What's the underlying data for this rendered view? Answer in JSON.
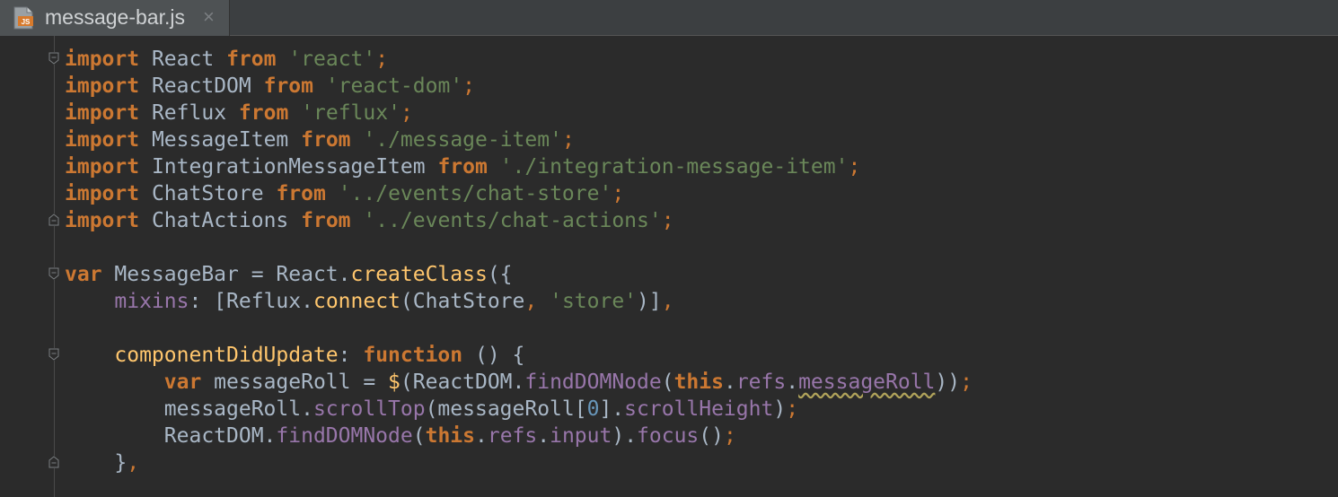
{
  "tab": {
    "filename": "message-bar.js",
    "close": "×",
    "icon_label": "JS"
  },
  "code": {
    "l1": {
      "kw": "import",
      "id": "React",
      "from": "from",
      "str": "'react'",
      "semi": ";"
    },
    "l2": {
      "kw": "import",
      "id": "ReactDOM",
      "from": "from",
      "str": "'react-dom'",
      "semi": ";"
    },
    "l3": {
      "kw": "import",
      "id": "Reflux",
      "from": "from",
      "str": "'reflux'",
      "semi": ";"
    },
    "l4": {
      "kw": "import",
      "id": "MessageItem",
      "from": "from",
      "str": "'./message-item'",
      "semi": ";"
    },
    "l5": {
      "kw": "import",
      "id": "IntegrationMessageItem",
      "from": "from",
      "str": "'./integration-message-item'",
      "semi": ";"
    },
    "l6": {
      "kw": "import",
      "id": "ChatStore",
      "from": "from",
      "str": "'../events/chat-store'",
      "semi": ";"
    },
    "l7": {
      "kw": "import",
      "id": "ChatActions",
      "from": "from",
      "str": "'../events/chat-actions'",
      "semi": ";"
    },
    "l8": {
      "kw": "var",
      "a": " MessageBar = React.",
      "fn": "createClass",
      "b": "({"
    },
    "l9": {
      "indent": "    ",
      "prop": "mixins",
      "a": ": [Reflux.",
      "fn": "connect",
      "b": "(ChatStore",
      "comma": ",",
      "str": " 'store'",
      "c": ")]",
      "comma2": ","
    },
    "l10": {
      "indent": "    ",
      "name": "componentDidUpdate",
      "a": ": ",
      "kw": "function",
      "b": " () {"
    },
    "l11": {
      "indent": "        ",
      "kw": "var",
      "a": " messageRoll = ",
      "dollar": "$",
      "b": "(ReactDOM.",
      "fn": "findDOMNode",
      "c": "(",
      "this": "this",
      "d": ".",
      "refs": "refs",
      "e": ".",
      "mr": "messageRoll",
      "f": "))",
      "semi": ";"
    },
    "l12": {
      "indent": "        ",
      "a": "messageRoll.",
      "fn": "scrollTop",
      "b": "(messageRoll[",
      "num": "0",
      "c": "].",
      "prop": "scrollHeight",
      "d": ")",
      "semi": ";"
    },
    "l13": {
      "indent": "        ",
      "a": "ReactDOM.",
      "fn": "findDOMNode",
      "b": "(",
      "this": "this",
      "c": ".",
      "refs": "refs",
      "d": ".",
      "input": "input",
      "e": ").",
      "fn2": "focus",
      "f": "()",
      "semi": ";"
    },
    "l14": {
      "indent": "    ",
      "a": "}",
      "comma": ","
    }
  }
}
